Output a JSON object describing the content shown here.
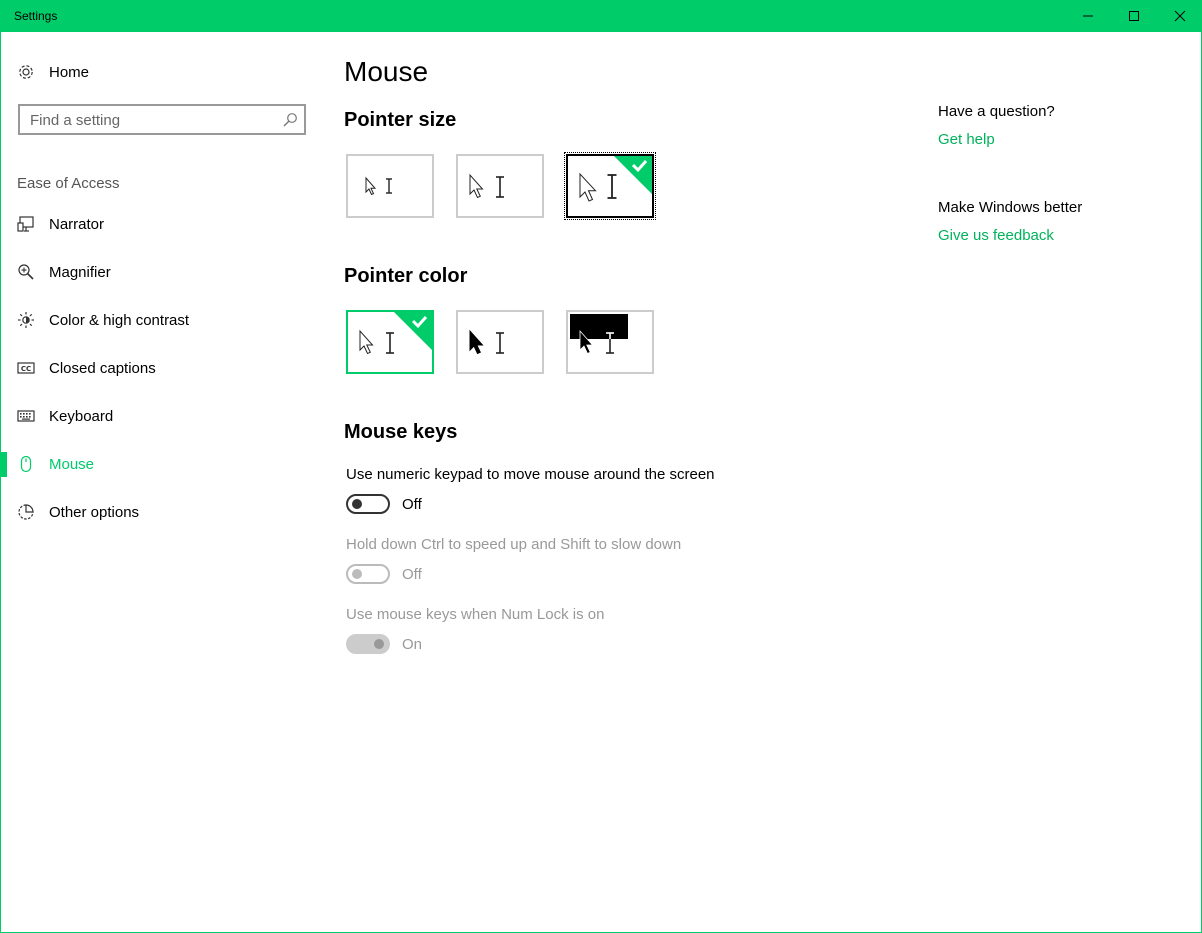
{
  "window": {
    "title": "Settings"
  },
  "sidebar": {
    "home_label": "Home",
    "search_placeholder": "Find a setting",
    "section_label": "Ease of Access",
    "items": [
      {
        "label": "Narrator",
        "icon": "narrator-icon"
      },
      {
        "label": "Magnifier",
        "icon": "magnifier-icon"
      },
      {
        "label": "Color & high contrast",
        "icon": "brightness-icon"
      },
      {
        "label": "Closed captions",
        "icon": "closed-captions-icon"
      },
      {
        "label": "Keyboard",
        "icon": "keyboard-icon"
      },
      {
        "label": "Mouse",
        "icon": "mouse-icon",
        "active": true
      },
      {
        "label": "Other options",
        "icon": "other-options-icon"
      }
    ]
  },
  "main": {
    "title": "Mouse",
    "pointer_size": {
      "heading": "Pointer size",
      "selected_index": 2
    },
    "pointer_color": {
      "heading": "Pointer color",
      "selected_index": 0
    },
    "mouse_keys": {
      "heading": "Mouse keys",
      "settings": [
        {
          "label": "Use numeric keypad to move mouse around the screen",
          "state": "Off",
          "enabled": true
        },
        {
          "label": "Hold down Ctrl to speed up and Shift to slow down",
          "state": "Off",
          "enabled": false
        },
        {
          "label": "Use mouse keys when Num Lock is on",
          "state": "On",
          "enabled": false
        }
      ]
    }
  },
  "right_panel": {
    "question_heading": "Have a question?",
    "get_help_link": "Get help",
    "feedback_heading": "Make Windows better",
    "feedback_link": "Give us feedback"
  },
  "colors": {
    "accent": "#00cc6a",
    "link": "#00b25c"
  }
}
